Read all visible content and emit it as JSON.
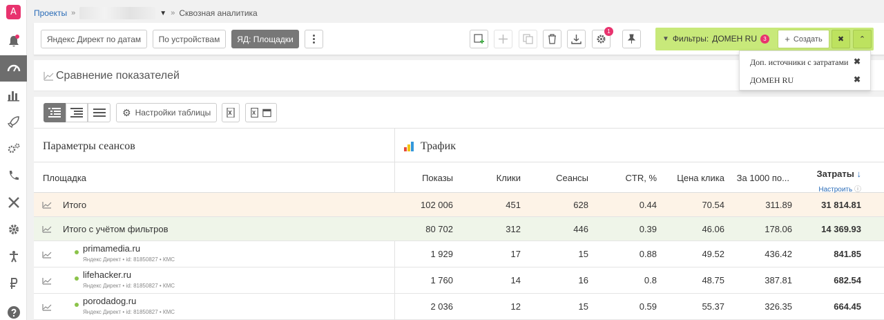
{
  "app": {
    "logo_letter": "A"
  },
  "breadcrumb": {
    "projects": "Проекты",
    "current": "Сквозная аналитика"
  },
  "toolbar": {
    "tab_yandex_dates": "Яндекс Директ по датам",
    "tab_devices": "По устройствам",
    "tab_placements": "ЯД: Площадки",
    "settings_badge": "1"
  },
  "filters": {
    "label": "Фильтры:",
    "value": "ДОМЕН RU",
    "count": "3",
    "create_label": "Создать"
  },
  "filter_dropdown": {
    "items": [
      {
        "label": "Доп. источники с затратами"
      },
      {
        "label": "ДОМЕН RU"
      }
    ]
  },
  "section": {
    "title": "Сравнение показателей"
  },
  "table_toolbar": {
    "settings_label": "Настройки таблицы"
  },
  "table": {
    "group_left": "Параметры сеансов",
    "group_right": "Трафик",
    "columns": {
      "placement": "Площадка",
      "impressions": "Показы",
      "clicks": "Клики",
      "sessions": "Сеансы",
      "ctr": "CTR, %",
      "cpc": "Цена клика",
      "cpm": "За 1000 по...",
      "cost": "Затраты",
      "cost_sort_icon": "arrow-down-icon",
      "configure": "Настроить"
    },
    "rows": [
      {
        "name": "Итого",
        "impressions": "102 006",
        "clicks": "451",
        "sessions": "628",
        "ctr": "0.44",
        "cpc": "70.54",
        "cpm": "311.89",
        "cost": "31 814.81"
      },
      {
        "name": "Итого с учётом фильтров",
        "impressions": "80 702",
        "clicks": "312",
        "sessions": "446",
        "ctr": "0.39",
        "cpc": "46.06",
        "cpm": "178.06",
        "cost": "14 369.93"
      },
      {
        "name": "primamedia.ru",
        "meta": "Яндекс Директ  •  id: 81850827  •  КМС",
        "impressions": "1 929",
        "clicks": "17",
        "sessions": "15",
        "ctr": "0.88",
        "cpc": "49.52",
        "cpm": "436.42",
        "cost": "841.85"
      },
      {
        "name": "lifehacker.ru",
        "meta": "Яндекс Директ  •  id: 81850827  •  КМС",
        "impressions": "1 760",
        "clicks": "14",
        "sessions": "16",
        "ctr": "0.8",
        "cpc": "48.75",
        "cpm": "387.81",
        "cost": "682.54"
      },
      {
        "name": "porodadog.ru",
        "meta": "Яндекс Директ  •  id: 81850827  •  КМС",
        "impressions": "2 036",
        "clicks": "12",
        "sessions": "15",
        "ctr": "0.59",
        "cpc": "55.37",
        "cpm": "326.35",
        "cost": "664.45"
      }
    ]
  },
  "colors": {
    "accent": "#e8336e",
    "filter_bg": "#c8e97a",
    "total_row": "#fdf3e7",
    "filtered_row": "#eff5e9",
    "link": "#2a6cb8"
  }
}
